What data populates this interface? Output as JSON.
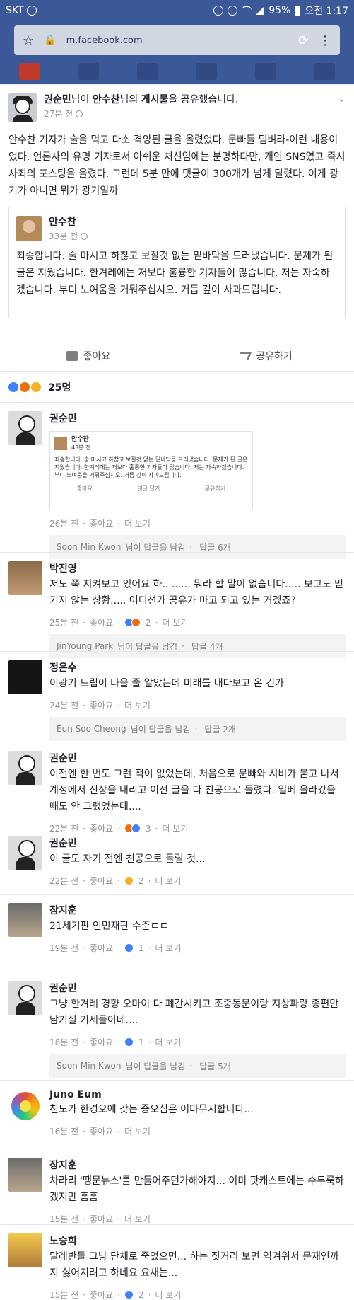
{
  "status": {
    "carrier": "SKT",
    "battery": "95%",
    "time": "오전 1:17"
  },
  "browser": {
    "url": "m.facebook.com"
  },
  "post": {
    "sharer": "권순민",
    "shared_text_1": "님이 ",
    "original_author": "안수찬",
    "shared_text_2": "님의 ",
    "shared_link": "게시물",
    "shared_text_3": "을 공유했습니다.",
    "time": "27분 전",
    "body": "안수찬 기자가 술을 먹고 다소 격앙된 글을 올렸었다. 문빠들 덤벼라-이런 내용이었다. 언론사의 유명 기자로서 아쉬운 처신임에는 분명하다만, 개인 SNS였고 즉시 사죄의 포스팅을 올렸다. 그런데 5분 만에 댓글이 300개가 넘게 달렸다. 이게 광기가 아니면 뭐가 광기일까",
    "shared_post": {
      "author": "안수찬",
      "time": "33분 전",
      "body": "죄송합니다. 술 마시고 하찮고 보잘것 없는 밑바닥을 드러냈습니다. 문제가 된 글은 지웠습니다. 한겨레에는 저보다 훌륭한 기자들이 많습니다. 저는 자숙하겠습니다. 부디 노여움을 거둬주십시오. 거듭 깊이 사과드립니다."
    }
  },
  "actions": {
    "like": "좋아요",
    "share": "공유하기"
  },
  "reactions": {
    "count": "25명"
  },
  "comments": [
    {
      "name": "권순민",
      "time": "26분 전",
      "like": "좋아요",
      "more": "더 보기",
      "preview": {
        "name": "안수찬",
        "time": "43분 전",
        "text": "죄송합니다. 술 마시고 하찮고 보잘것 없는 밑바닥을 드러냈습니다. 문제가 된 글은 지웠습니다. 한겨레에는 저보다 훌륭한 기자들이 많습니다. 저는 자숙하겠습니다. 부디 노여움을 거둬주십시오. 거듭 깊이 사과드립니다.",
        "like": "좋아요",
        "comment": "댓글 달기",
        "share": "공유하기"
      },
      "reply_name": "Soon Min Kwon",
      "reply_suffix": "님이 답글을 남김",
      "reply_count": "답글 6개"
    },
    {
      "name": "박진영",
      "text": "저도 쭉 지켜보고 있어요 하......... 뭐라 할 말이 없습니다..... 보고도 믿기지 않는 상황..... 어디선가 공유가 마고 되고 있는 거겠죠?",
      "time": "25분 전",
      "like": "좋아요",
      "reactions": "2",
      "more": "더 보기",
      "reply_name": "JinYoung Park",
      "reply_suffix": "님이 답글을 남김",
      "reply_count": "답글 4개"
    },
    {
      "name": "정은수",
      "text": "이광기 드립이 나올 줄 알았는데 미래를 내다보고 온 건가",
      "time": "24분 전",
      "like": "좋아요",
      "more": "더 보기",
      "reply_name": "Eun Soo Cheong",
      "reply_suffix": "님이 답글을 남김",
      "reply_count": "답글 2개"
    },
    {
      "name": "권순민",
      "text": "이전엔 한 번도 그런 적이 없었는데, 처음으로 문빠와 시비가 붙고 나서 계정에서 신상을 내리고 이전 글을 다 친공으로 돌렸다. 일베 올라갔을 때도 안 그랬었는데....",
      "time": "22분 전",
      "like": "좋아요",
      "reactions": "3",
      "more": "더 보기"
    },
    {
      "name": "권순민",
      "text": "이 글도 자기 전엔 친공으로 돌릴 것...",
      "time": "22분 전",
      "like": "좋아요",
      "reactions": "2",
      "more": "더 보기"
    },
    {
      "name": "장지훈",
      "text": "21세기판 인민재판 수준ㄷㄷ",
      "time": "19분 전",
      "like": "좋아요",
      "reactions": "1",
      "more": "더 보기"
    },
    {
      "name": "권순민",
      "text": "그냥 한겨레 경향 오마이 다 폐간시키고 조중동문이랑 지상파랑 종편만 남기실 기세들이네....",
      "time": "18분 전",
      "like": "좋아요",
      "reactions": "1",
      "more": "더 보기",
      "reply_name": "Soon Min Kwon",
      "reply_suffix": "님이 답글을 남김",
      "reply_count": "답글 5개"
    },
    {
      "name": "Juno Eum",
      "text": "친노가 한경오에 갖는 증오심은 어마무시합니다...",
      "time": "16분 전",
      "like": "좋아요",
      "more": "더 보기"
    },
    {
      "name": "장지훈",
      "text": "차라리 '땡문뉴스'를 만들어주던가해야지... 이미 팟캐스트에는 수두룩하겠지만 흠흠",
      "time": "15분 전",
      "like": "좋아요",
      "more": "더 보기"
    },
    {
      "name": "노승희",
      "text": "달레반들 그냥 단체로 죽었으면... 하는 짓거리 보면 역겨워서 문재인까지 싫어지려고 하네요 요새는...",
      "time": "15분 전",
      "like": "좋아요",
      "reactions": "2",
      "more": "더 보기"
    }
  ],
  "colors": {
    "facebook_blue": "#3b5998",
    "like_blue": "#4080ff",
    "angry_orange": "#e9710f",
    "sad_yellow": "#f7b125"
  }
}
